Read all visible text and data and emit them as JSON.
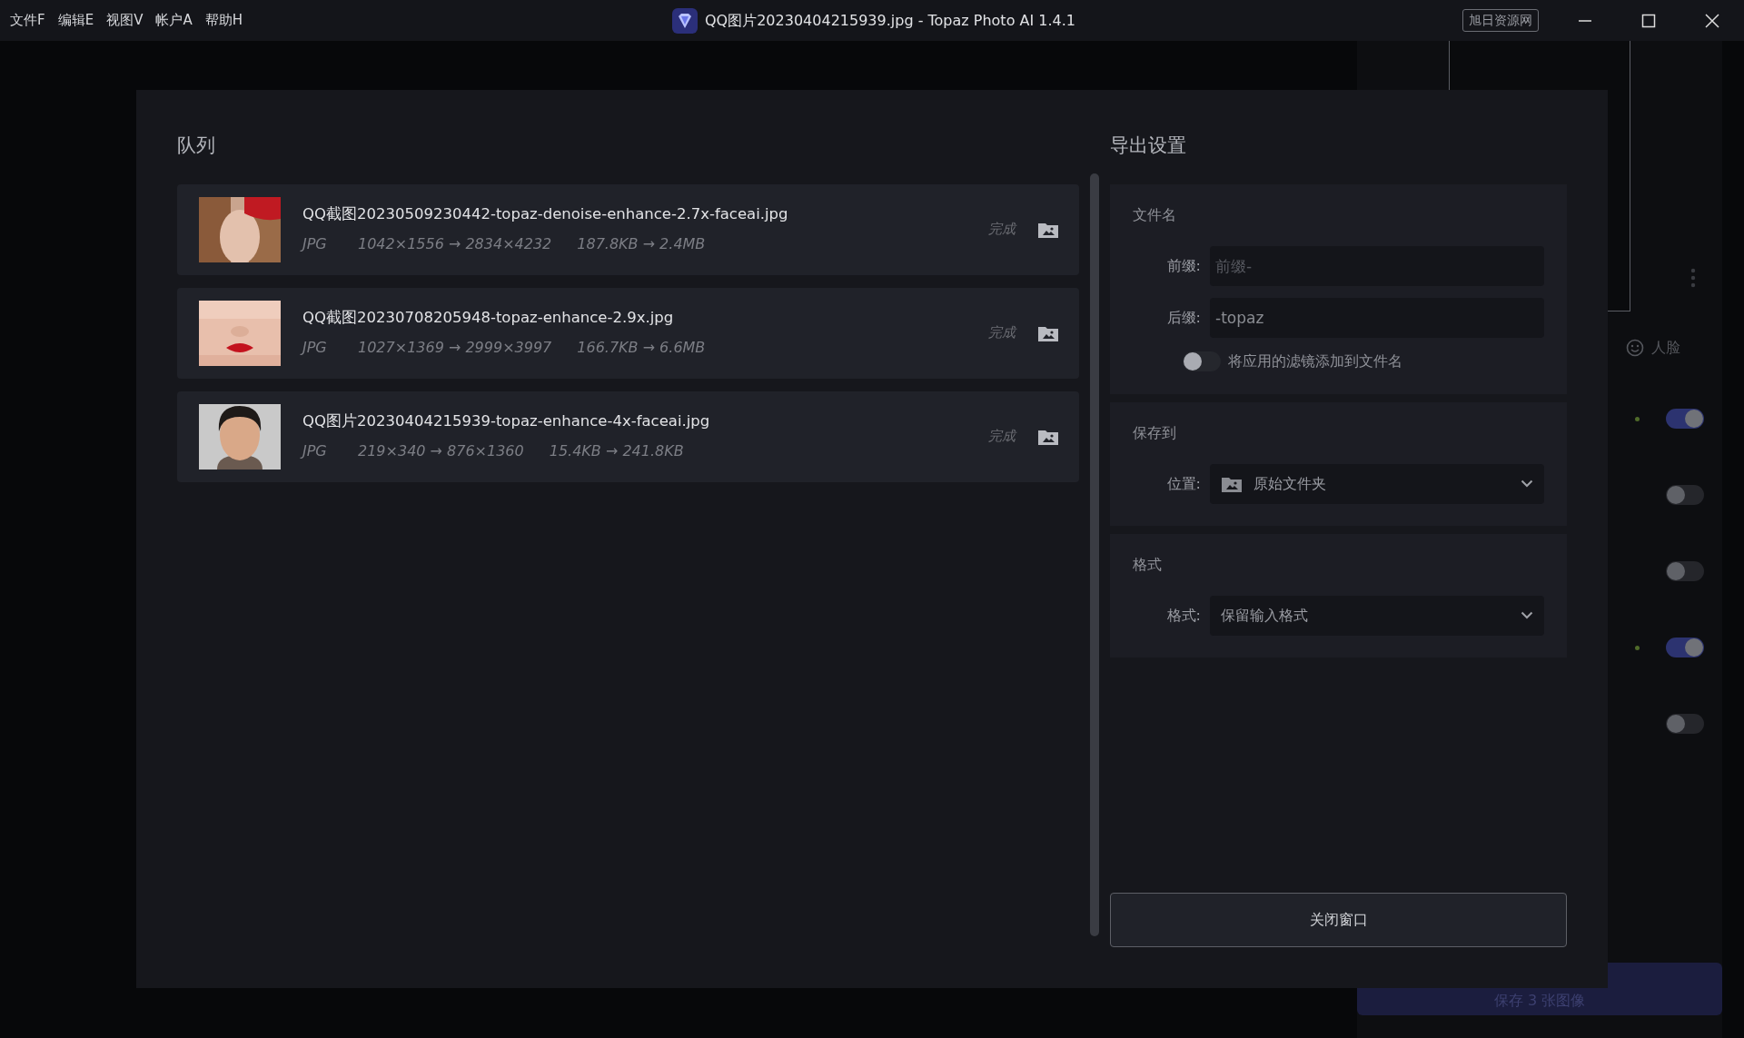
{
  "menu": [
    {
      "label": "文件F"
    },
    {
      "label": "编辑E"
    },
    {
      "label": "视图V"
    },
    {
      "label": "帐户A"
    },
    {
      "label": "帮助H"
    }
  ],
  "window": {
    "title": "QQ图片20230404215939.jpg - Topaz Photo AI 1.4.1",
    "badge": "旭日资源网"
  },
  "background": {
    "face_label": "人脸",
    "toggles": [
      {
        "on": true
      },
      {
        "on": false
      },
      {
        "on": false
      },
      {
        "on": true
      },
      {
        "on": false
      }
    ],
    "save_button": "保存 3 张图像"
  },
  "queue": {
    "title": "队列",
    "items": [
      {
        "kind": "picture",
        "name": "QQ截图20230509230442-topaz-denoise-enhance-2.7x-faceai.jpg",
        "format": "JPG",
        "dimensions": "1042×1556 → 2834×4232",
        "size": "187.8KB → 2.4MB",
        "status": "完成"
      },
      {
        "kind": "picture",
        "name": "QQ截图20230708205948-topaz-enhance-2.9x.jpg",
        "format": "JPG",
        "dimensions": "1027×1369 → 2999×3997",
        "size": "166.7KB → 6.6MB",
        "status": "完成"
      },
      {
        "kind": "picture",
        "name": "QQ图片20230404215939-topaz-enhance-4x-faceai.jpg",
        "format": "JPG",
        "dimensions": "219×340 → 876×1360",
        "size": "15.4KB → 241.8KB",
        "status": "完成"
      }
    ]
  },
  "export": {
    "title": "导出设置",
    "filename": {
      "title": "文件名",
      "prefix": {
        "label": "前缀:",
        "placeholder": "前缀-"
      },
      "suffix": {
        "label": "后缀:",
        "value": "-topaz"
      },
      "toggle": {
        "label": "将应用的滤镜添加到文件名",
        "on": false
      }
    },
    "save_to": {
      "title": "保存到",
      "label": "位置:",
      "value": "原始文件夹"
    },
    "format": {
      "title": "格式",
      "label": "格式:",
      "value": "保留输入格式"
    },
    "close_button": "关闭窗口"
  }
}
